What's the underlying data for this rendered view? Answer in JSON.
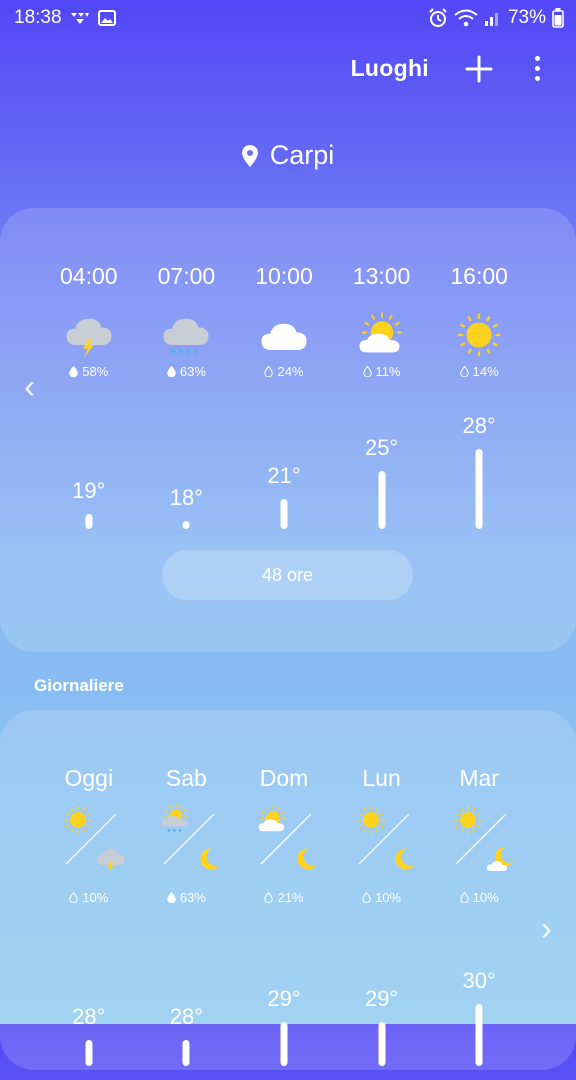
{
  "status_bar": {
    "time": "18:38",
    "battery": "73%"
  },
  "header": {
    "places_label": "Luoghi"
  },
  "location": {
    "name": "Carpi"
  },
  "hourly": {
    "items": [
      {
        "time": "04:00",
        "icon": "thunderstorm-icon",
        "precip": "58%",
        "temp": "19°",
        "temp_value": 19
      },
      {
        "time": "07:00",
        "icon": "rain-icon",
        "precip": "63%",
        "temp": "18°",
        "temp_value": 18
      },
      {
        "time": "10:00",
        "icon": "cloudy-icon",
        "precip": "24%",
        "temp": "21°",
        "temp_value": 21
      },
      {
        "time": "13:00",
        "icon": "partly-sunny-icon",
        "precip": "11%",
        "temp": "25°",
        "temp_value": 25
      },
      {
        "time": "16:00",
        "icon": "sunny-icon",
        "precip": "14%",
        "temp": "28°",
        "temp_value": 28
      }
    ],
    "button_label": "48 ore"
  },
  "daily": {
    "title": "Giornaliere",
    "items": [
      {
        "day": "Oggi",
        "icon_day": "sunny-icon",
        "icon_night": "thunderstorm-icon",
        "precip": "10%",
        "temp": "28°",
        "temp_value": 28
      },
      {
        "day": "Sab",
        "icon_day": "partly-sunny-rain-icon",
        "icon_night": "moon-icon",
        "precip": "63%",
        "temp": "28°",
        "temp_value": 28
      },
      {
        "day": "Dom",
        "icon_day": "partly-sunny-icon",
        "icon_night": "moon-icon",
        "precip": "21%",
        "temp": "29°",
        "temp_value": 29
      },
      {
        "day": "Lun",
        "icon_day": "sunny-icon",
        "icon_night": "moon-icon",
        "precip": "10%",
        "temp": "29°",
        "temp_value": 29
      },
      {
        "day": "Mar",
        "icon_day": "sunny-icon",
        "icon_night": "moon-cloud-icon",
        "precip": "10%",
        "temp": "30°",
        "temp_value": 30
      }
    ]
  },
  "colors": {
    "sun": "#ffd21f",
    "cloud": "#ffffff",
    "rain_cloud": "#c9cdd6"
  }
}
